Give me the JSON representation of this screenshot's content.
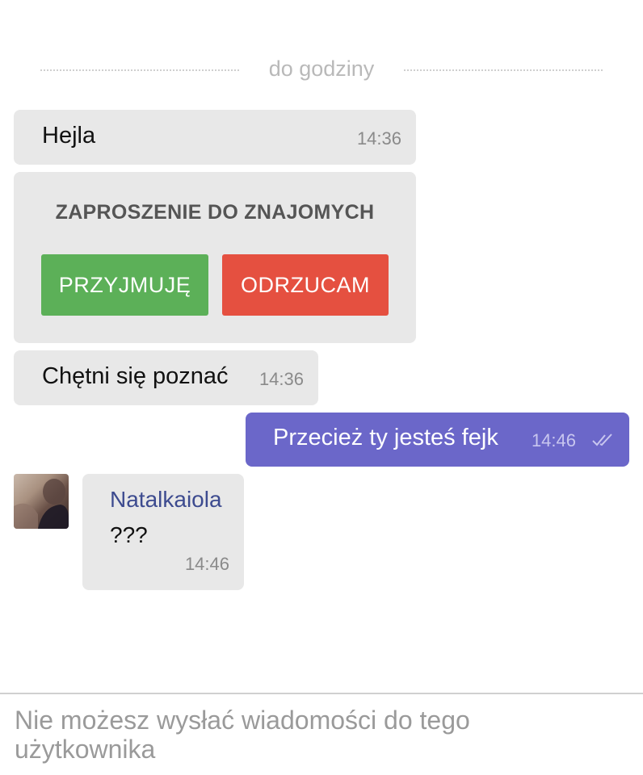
{
  "chat": {
    "date_divider": "do godziny",
    "messages": [
      {
        "text": "Hejla",
        "time": "14:36"
      },
      {
        "text": "Chętni się poznać",
        "time": "14:36"
      },
      {
        "text": "Przecież ty jesteś fejk",
        "time": "14:46",
        "status_icon": "double-check-icon"
      },
      {
        "sender": "Natalkaiola",
        "text": "???",
        "time": "14:46"
      }
    ],
    "invite": {
      "title": "ZAPROSZENIE DO ZNAJOMYCH",
      "accept_label": "PRZYJMUJĘ",
      "reject_label": "ODRZUCAM",
      "accept_color": "#5cb058",
      "reject_color": "#e55040"
    }
  },
  "composer": {
    "placeholder": "Nie możesz wysłać wiadomości do tego użytkownika"
  },
  "colors": {
    "outgoing_bubble": "#6b67c9",
    "incoming_bubble": "#e8e8e8",
    "sender_name": "#3d4b8f"
  }
}
